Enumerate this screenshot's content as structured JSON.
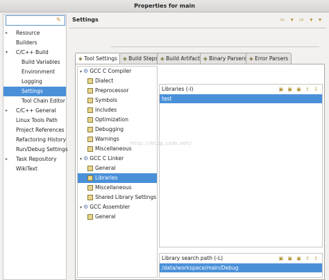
{
  "window": {
    "title": "Properties for main"
  },
  "filter": {
    "placeholder": ""
  },
  "nav": {
    "items": [
      {
        "label": "Resource",
        "expander": "▸",
        "indent": 0
      },
      {
        "label": "Builders",
        "expander": "",
        "indent": 0
      },
      {
        "label": "C/C++ Build",
        "expander": "▾",
        "indent": 0
      },
      {
        "label": "Build Variables",
        "expander": "",
        "indent": 1
      },
      {
        "label": "Environment",
        "expander": "",
        "indent": 1
      },
      {
        "label": "Logging",
        "expander": "",
        "indent": 1
      },
      {
        "label": "Settings",
        "expander": "",
        "indent": 1,
        "selected": true
      },
      {
        "label": "Tool Chain Editor",
        "expander": "",
        "indent": 1
      },
      {
        "label": "C/C++ General",
        "expander": "▸",
        "indent": 0
      },
      {
        "label": "Linux Tools Path",
        "expander": "",
        "indent": 0
      },
      {
        "label": "Project References",
        "expander": "",
        "indent": 0
      },
      {
        "label": "Refactoring History",
        "expander": "",
        "indent": 0
      },
      {
        "label": "Run/Debug Settings",
        "expander": "",
        "indent": 0
      },
      {
        "label": "Task Repository",
        "expander": "▸",
        "indent": 0
      },
      {
        "label": "WikiText",
        "expander": "",
        "indent": 0
      }
    ]
  },
  "header": {
    "title": "Settings",
    "tools": "⇦ ▾ ⇨ ▾ ▾"
  },
  "tabs": [
    {
      "label": "Tool Settings",
      "active": true
    },
    {
      "label": "Build Steps"
    },
    {
      "label": "Build Artifact"
    },
    {
      "label": "Binary Parsers"
    },
    {
      "label": "Error Parsers"
    }
  ],
  "tree": {
    "items": [
      {
        "label": "GCC C Compiler",
        "type": "group"
      },
      {
        "label": "Dialect",
        "type": "leaf"
      },
      {
        "label": "Preprocessor",
        "type": "leaf"
      },
      {
        "label": "Symbols",
        "type": "leaf"
      },
      {
        "label": "Includes",
        "type": "leaf"
      },
      {
        "label": "Optimization",
        "type": "leaf"
      },
      {
        "label": "Debugging",
        "type": "leaf"
      },
      {
        "label": "Warnings",
        "type": "leaf"
      },
      {
        "label": "Miscellaneous",
        "type": "leaf"
      },
      {
        "label": "GCC C Linker",
        "type": "group"
      },
      {
        "label": "General",
        "type": "leaf"
      },
      {
        "label": "Libraries",
        "type": "leaf",
        "selected": true
      },
      {
        "label": "Miscellaneous",
        "type": "leaf"
      },
      {
        "label": "Shared Library Settings",
        "type": "leaf"
      },
      {
        "label": "GCC Assembler",
        "type": "group"
      },
      {
        "label": "General",
        "type": "leaf"
      }
    ]
  },
  "watermark": "http://blog.csdn.net/",
  "libraries": {
    "title": "Libraries (-l)",
    "tools": "▣ ▣ ▣ ⇧ ⇩",
    "rows": [
      "test"
    ]
  },
  "libpath": {
    "title": "Library search path (-L)",
    "tools": "▣ ▣ ▣ ⇧ ⇩",
    "rows": [
      "/data/workspace/main/Debug"
    ]
  }
}
